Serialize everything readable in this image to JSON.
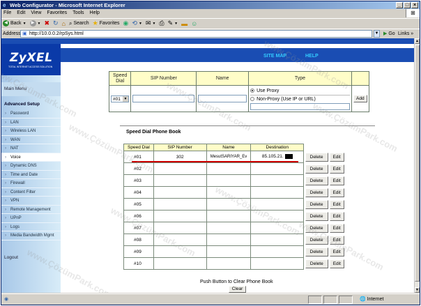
{
  "window": {
    "title": "Web Configurator - Microsoft Internet Explorer"
  },
  "menu": [
    "File",
    "Edit",
    "View",
    "Favorites",
    "Tools",
    "Help"
  ],
  "toolbar": {
    "back": "Back",
    "search": "Search",
    "favorites": "Favorites"
  },
  "address": {
    "label": "Address",
    "url": "http://10.0.0.2/rpSys.html",
    "go": "Go",
    "links": "Links"
  },
  "status": {
    "zone": "Internet"
  },
  "header": {
    "logo": "ZyXEL",
    "logo_sub": "TOTAL INTERNET ACCESS SOLUTION",
    "site_map": "SITE MAP",
    "help": "HELP"
  },
  "sidebar": {
    "main_menu": "Main Menu",
    "advanced": "Advanced Setup",
    "items": [
      "Password",
      "LAN",
      "Wireless LAN",
      "WAN",
      "NAT",
      "Voice",
      "Dynamic DNS",
      "Time and Date",
      "Firewall",
      "Content Filter",
      "VPN",
      "Remote Management",
      "UPnP",
      "Logs",
      "Media Bandwidth Mgmt"
    ],
    "active_index": 5,
    "logout": "Logout"
  },
  "entry": {
    "headers": [
      "Speed Dial",
      "SIP Number",
      "Name",
      "Type"
    ],
    "speed_dial_value": "#01",
    "radio_use_proxy": "Use Proxy",
    "radio_non_proxy": "Non-Proxy (Use IP or URL)",
    "add_label": "Add"
  },
  "phonebook": {
    "title": "Speed Dial Phone Book",
    "headers": [
      "Speed Dial",
      "SIP Number",
      "Name",
      "Destination"
    ],
    "rows": [
      {
        "dial": "#01",
        "sip": "302",
        "name": "MesutSARIYAR_Ev",
        "dest": "85.105.21."
      },
      {
        "dial": "#02",
        "sip": "",
        "name": "",
        "dest": ""
      },
      {
        "dial": "#03",
        "sip": "",
        "name": "",
        "dest": ""
      },
      {
        "dial": "#04",
        "sip": "",
        "name": "",
        "dest": ""
      },
      {
        "dial": "#05",
        "sip": "",
        "name": "",
        "dest": ""
      },
      {
        "dial": "#06",
        "sip": "",
        "name": "",
        "dest": ""
      },
      {
        "dial": "#07",
        "sip": "",
        "name": "",
        "dest": ""
      },
      {
        "dial": "#08",
        "sip": "",
        "name": "",
        "dest": ""
      },
      {
        "dial": "#09",
        "sip": "",
        "name": "",
        "dest": ""
      },
      {
        "dial": "#10",
        "sip": "",
        "name": "",
        "dest": ""
      }
    ],
    "delete_label": "Delete",
    "edit_label": "Edit",
    "push_text": "Push Button to Clear Phone Book",
    "clear_label": "Clear"
  },
  "watermark": "www.ÇözümPark.com"
}
